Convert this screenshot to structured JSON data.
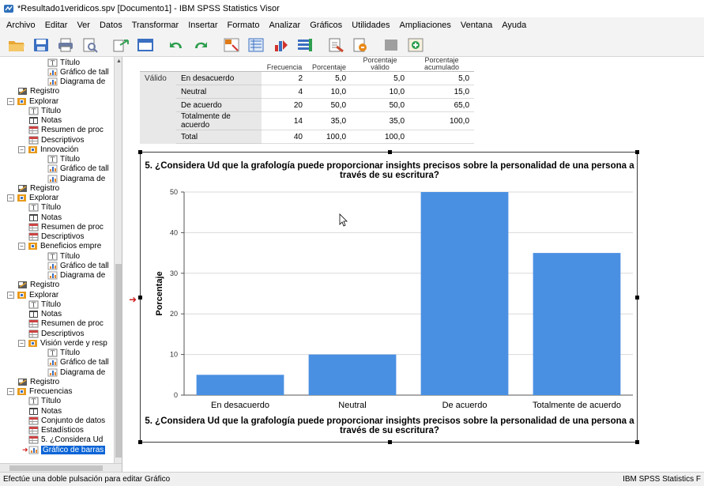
{
  "window": {
    "title": "*Resultado1veridicos.spv [Documento1] - IBM SPSS Statistics Visor"
  },
  "menu": [
    {
      "label": "Archivo"
    },
    {
      "label": "Editar"
    },
    {
      "label": "Ver"
    },
    {
      "label": "Datos"
    },
    {
      "label": "Transformar"
    },
    {
      "label": "Insertar"
    },
    {
      "label": "Formato"
    },
    {
      "label": "Analizar"
    },
    {
      "label": "Gráficos"
    },
    {
      "label": "Utilidades"
    },
    {
      "label": "Ampliaciones"
    },
    {
      "label": "Ventana"
    },
    {
      "label": "Ayuda"
    }
  ],
  "toolbar": [
    {
      "icon": "open-folder-icon",
      "color": "#e8a735"
    },
    {
      "icon": "save-icon",
      "color": "#3a6fc1"
    },
    {
      "icon": "print-icon",
      "color": "#6b7ca4"
    },
    {
      "icon": "print-preview-icon",
      "color": "#6b7ca4"
    },
    {
      "icon": "export-icon",
      "color": "#3aa157"
    },
    {
      "icon": "recall-dialog-icon",
      "color": "#3a6fc1"
    },
    {
      "icon": "undo-icon",
      "color": "#2e9e4f"
    },
    {
      "icon": "redo-icon",
      "color": "#2e9e4f"
    },
    {
      "icon": "goto-data-icon",
      "color": "#e07b1a"
    },
    {
      "icon": "goto-case-icon",
      "color": "#3a6fc1"
    },
    {
      "icon": "variables-icon",
      "color": "#d2322d"
    },
    {
      "icon": "use-sets-icon",
      "color": "#3a6fc1"
    },
    {
      "icon": "designate-window-icon",
      "color": "#c84a2f"
    },
    {
      "icon": "select-last-output-icon",
      "color": "#e88a1a"
    },
    {
      "icon": "disabled-tool-icon",
      "color": "#8a8a8a"
    },
    {
      "icon": "add-icon",
      "color": "#2e9e4f"
    }
  ],
  "navigator": {
    "items": [
      {
        "label": "Título",
        "type": "title",
        "depth": 3
      },
      {
        "label": "Gráfico de tall",
        "type": "chart",
        "depth": 3
      },
      {
        "label": "Diagrama de",
        "type": "chart",
        "depth": 3
      },
      {
        "label": "Registro",
        "type": "log",
        "depth": 1
      },
      {
        "label": "Explorar",
        "type": "folder",
        "depth": 1,
        "expander": "−"
      },
      {
        "label": "Título",
        "type": "title",
        "depth": 2
      },
      {
        "label": "Notas",
        "type": "notes",
        "depth": 2
      },
      {
        "label": "Resumen de proc",
        "type": "table",
        "depth": 2
      },
      {
        "label": "Descriptivos",
        "type": "table",
        "depth": 2
      },
      {
        "label": "Innovación",
        "type": "folder",
        "depth": 2,
        "expander": "−"
      },
      {
        "label": "Título",
        "type": "title",
        "depth": 3
      },
      {
        "label": "Gráfico de tall",
        "type": "chart",
        "depth": 3
      },
      {
        "label": "Diagrama de",
        "type": "chart",
        "depth": 3
      },
      {
        "label": "Registro",
        "type": "log",
        "depth": 1
      },
      {
        "label": "Explorar",
        "type": "folder",
        "depth": 1,
        "expander": "−"
      },
      {
        "label": "Título",
        "type": "title",
        "depth": 2
      },
      {
        "label": "Notas",
        "type": "notes",
        "depth": 2
      },
      {
        "label": "Resumen de proc",
        "type": "table",
        "depth": 2
      },
      {
        "label": "Descriptivos",
        "type": "table",
        "depth": 2
      },
      {
        "label": "Beneficios empre",
        "type": "folder",
        "depth": 2,
        "expander": "−"
      },
      {
        "label": "Título",
        "type": "title",
        "depth": 3
      },
      {
        "label": "Gráfico de tall",
        "type": "chart",
        "depth": 3
      },
      {
        "label": "Diagrama de",
        "type": "chart",
        "depth": 3
      },
      {
        "label": "Registro",
        "type": "log",
        "depth": 1
      },
      {
        "label": "Explorar",
        "type": "folder",
        "depth": 1,
        "expander": "−"
      },
      {
        "label": "Título",
        "type": "title",
        "depth": 2
      },
      {
        "label": "Notas",
        "type": "notes",
        "depth": 2
      },
      {
        "label": "Resumen de proc",
        "type": "table",
        "depth": 2
      },
      {
        "label": "Descriptivos",
        "type": "table",
        "depth": 2
      },
      {
        "label": "Visión verde y resp",
        "type": "folder",
        "depth": 2,
        "expander": "−"
      },
      {
        "label": "Título",
        "type": "title",
        "depth": 3
      },
      {
        "label": "Gráfico de tall",
        "type": "chart",
        "depth": 3
      },
      {
        "label": "Diagrama de",
        "type": "chart",
        "depth": 3
      },
      {
        "label": "Registro",
        "type": "log",
        "depth": 1
      },
      {
        "label": "Frecuencias",
        "type": "folder",
        "depth": 1,
        "expander": "−"
      },
      {
        "label": "Título",
        "type": "title",
        "depth": 2
      },
      {
        "label": "Notas",
        "type": "notes",
        "depth": 2
      },
      {
        "label": "Conjunto de datos",
        "type": "table",
        "depth": 2
      },
      {
        "label": "Estadísticos",
        "type": "table",
        "depth": 2
      },
      {
        "label": "5. ¿Considera Ud",
        "type": "table",
        "depth": 2
      },
      {
        "label": "Gráfico de barras",
        "type": "chart",
        "depth": 2,
        "selected": true
      }
    ]
  },
  "freq_table": {
    "headers": [
      "Frecuencia",
      "Porcentaje",
      "Porcentaje válido",
      "Porcentaje acumulado"
    ],
    "group_label": "Válido",
    "rows": [
      {
        "label": "En desacuerdo",
        "freq": "2",
        "pct": "5,0",
        "valid": "5,0",
        "cum": "5,0"
      },
      {
        "label": "Neutral",
        "freq": "4",
        "pct": "10,0",
        "valid": "10,0",
        "cum": "15,0"
      },
      {
        "label": "De acuerdo",
        "freq": "20",
        "pct": "50,0",
        "valid": "50,0",
        "cum": "65,0"
      },
      {
        "label": "Totalmente de acuerdo",
        "freq": "14",
        "pct": "35,0",
        "valid": "35,0",
        "cum": "100,0"
      },
      {
        "label": "Total",
        "freq": "40",
        "pct": "100,0",
        "valid": "100,0",
        "cum": ""
      }
    ]
  },
  "chart_data": {
    "type": "bar",
    "title": "5. ¿Considera Ud  que la grafología puede proporcionar insights precisos sobre la personalidad de una persona a través de su escritura?",
    "footnote": "5. ¿Considera Ud  que la grafología puede proporcionar insights precisos sobre la personalidad de una persona a través de su escritura?",
    "categories": [
      "En desacuerdo",
      "Neutral",
      "De acuerdo",
      "Totalmente de acuerdo"
    ],
    "values": [
      5,
      10,
      50,
      35
    ],
    "xlabel": "",
    "ylabel": "Porcentaje",
    "ylim": [
      0,
      50
    ],
    "yticks": [
      0,
      10,
      20,
      30,
      40,
      50
    ],
    "bar_color": "#4a90e2",
    "grid": true
  },
  "statusbar": {
    "left": "Efectúe una doble pulsación para editar Gráfico",
    "right": "IBM SPSS Statistics F"
  }
}
